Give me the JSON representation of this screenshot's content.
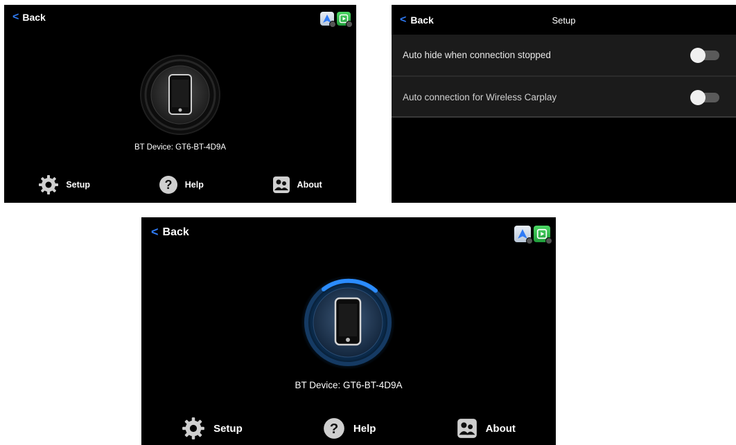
{
  "panel1": {
    "back_chevron": "<",
    "back_label": "Back",
    "device_label": "BT Device: GT6-BT-4D9A",
    "nav": {
      "setup": "Setup",
      "help": "Help",
      "about": "About"
    }
  },
  "panel2": {
    "back_chevron": "<",
    "back_label": "Back",
    "title": "Setup",
    "settings": [
      {
        "label": "Auto hide when connection stopped",
        "enabled": false
      },
      {
        "label": "Auto connection for Wireless Carplay",
        "enabled": false
      }
    ]
  },
  "panel3": {
    "back_chevron": "<",
    "back_label": "Back",
    "device_label": "BT Device: GT6-BT-4D9A",
    "nav": {
      "setup": "Setup",
      "help": "Help",
      "about": "About"
    }
  },
  "icons": {
    "android_auto": "android-auto-icon",
    "carplay": "carplay-icon",
    "phone": "phone-icon",
    "setup": "gear-icon",
    "help": "help-icon",
    "about": "contacts-icon"
  },
  "colors": {
    "accent": "#2f7bf6",
    "background": "#000000",
    "settings_bg": "#1b1b1b",
    "toggle_off": "#5a5a5a"
  }
}
